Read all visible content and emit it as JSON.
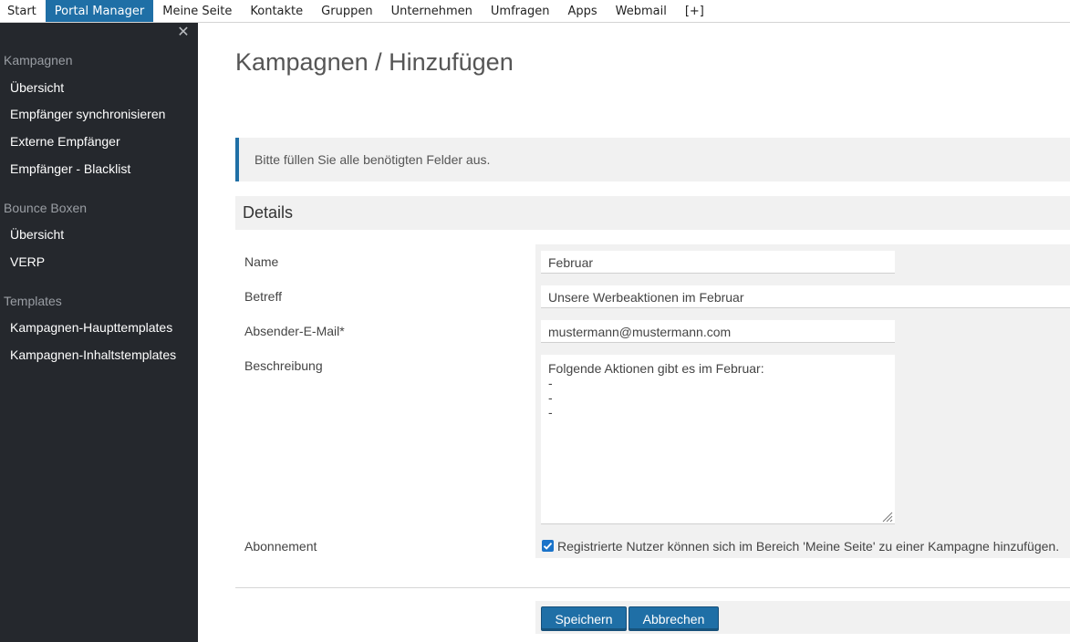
{
  "topnav": {
    "items": [
      "Start",
      "Portal Manager",
      "Meine Seite",
      "Kontakte",
      "Gruppen",
      "Unternehmen",
      "Umfragen",
      "Apps",
      "Webmail",
      "[+]"
    ],
    "active_index": 1
  },
  "sidebar": {
    "close_glyph": "✕",
    "section_kampagnen": "Kampagnen",
    "kampagnen_items": [
      "Übersicht",
      "Empfänger synchronisieren",
      "Externe Empfänger",
      "Empfänger - Blacklist"
    ],
    "section_bounce": "Bounce Boxen",
    "bounce_items": [
      "Übersicht",
      "VERP"
    ],
    "section_templates": "Templates",
    "template_items": [
      "Kampagnen-Haupttemplates",
      "Kampagnen-Inhaltstemplates"
    ]
  },
  "main": {
    "title": "Kampagnen / Hinzufügen",
    "info": "Bitte füllen Sie alle benötigten Felder aus.",
    "details_header": "Details",
    "labels": {
      "name": "Name",
      "subject": "Betreff",
      "sender_email": "Absender-E-Mail*",
      "description": "Beschreibung",
      "subscription": "Abonnement"
    },
    "values": {
      "name": "Februar",
      "subject": "Unsere Werbeaktionen im Februar",
      "sender_email": "mustermann@mustermann.com",
      "description": "Folgende Aktionen gibt es im Februar:\n-\n-\n-",
      "subscription_text": "Registrierte Nutzer können sich im Bereich 'Meine Seite' zu einer Kampagne hinzufügen.",
      "subscription_checked": true
    },
    "buttons": {
      "save": "Speichern",
      "cancel": "Abbrechen"
    }
  }
}
